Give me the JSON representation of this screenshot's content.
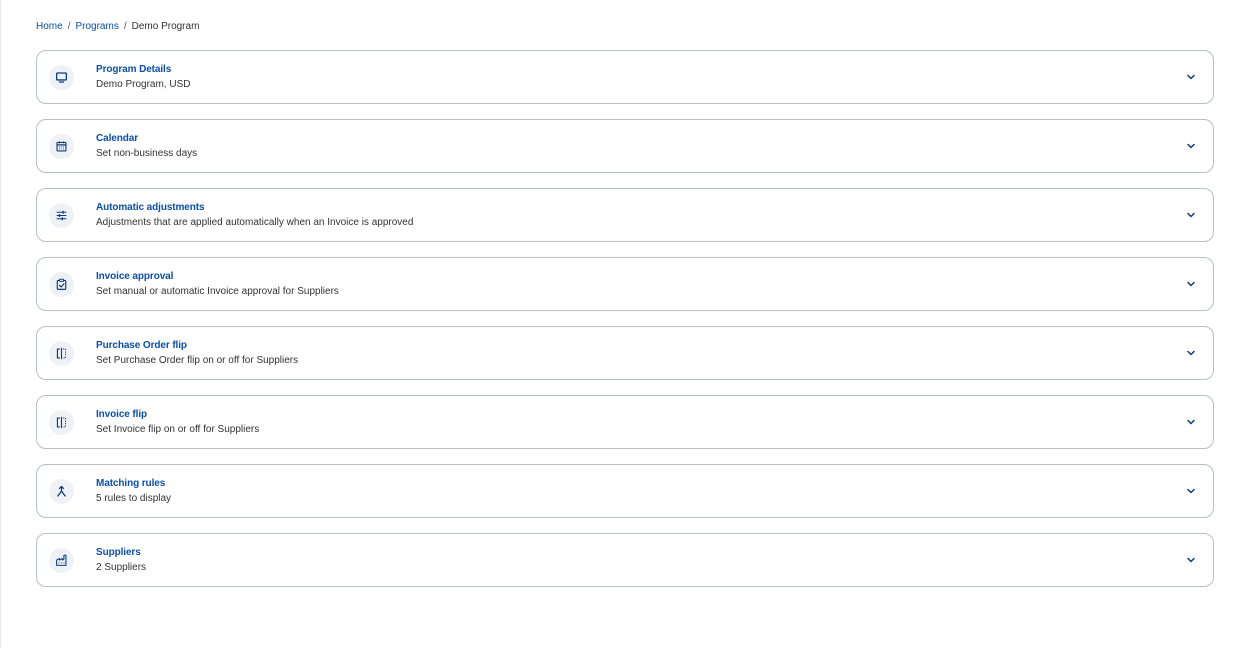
{
  "breadcrumb": {
    "home": "Home",
    "programs": "Programs",
    "current": "Demo Program",
    "separator": "/"
  },
  "colors": {
    "accent": "#0b4fa8",
    "border": "#b9bec7",
    "icon_bg": "#eef1f6"
  },
  "panels": [
    {
      "title": "Program Details",
      "subtitle": "Demo Program, USD",
      "icon": "monitor-icon"
    },
    {
      "title": "Calendar",
      "subtitle": "Set non-business days",
      "icon": "calendar-icon"
    },
    {
      "title": "Automatic adjustments",
      "subtitle": "Adjustments that are applied automatically when an Invoice is approved",
      "icon": "sliders-icon"
    },
    {
      "title": "Invoice approval",
      "subtitle": "Set manual or automatic Invoice approval for Suppliers",
      "icon": "clipboard-check-icon"
    },
    {
      "title": "Purchase Order flip",
      "subtitle": "Set Purchase Order flip on or off for Suppliers",
      "icon": "flip-icon"
    },
    {
      "title": "Invoice flip",
      "subtitle": "Set Invoice flip on or off for Suppliers",
      "icon": "flip-icon"
    },
    {
      "title": "Matching rules",
      "subtitle": "5 rules to display",
      "icon": "merge-icon"
    },
    {
      "title": "Suppliers",
      "subtitle": "2 Suppliers",
      "icon": "factory-icon"
    }
  ]
}
